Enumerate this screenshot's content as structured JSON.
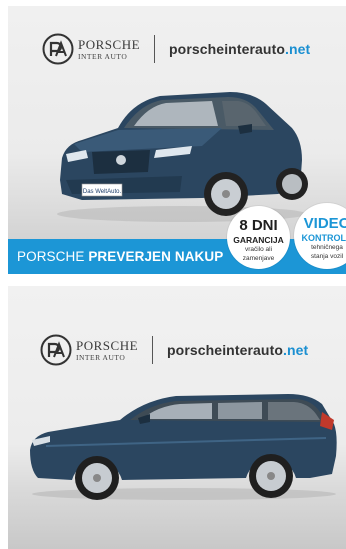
{
  "top_photo": {
    "brand_name": "PORSCHE",
    "brand_sub": "INTER AUTO",
    "website_main": "porscheinterauto",
    "website_tld": ".net",
    "plate_text": "Das WeltAuto.",
    "banner_regular": "PORSCHE",
    "banner_bold": "PREVERJEN NAKUP",
    "badge_guarantee": {
      "big": "8 DNI",
      "mid": "GARANCIJA",
      "line1": "vračilo ali",
      "line2": "zamenjave"
    },
    "badge_video": {
      "big": "VIDEO",
      "mid": "KONTROLA",
      "line1": "tehničnega",
      "line2": "stanja vozil"
    }
  },
  "bottom_photo": {
    "brand_name": "PORSCHE",
    "brand_sub": "INTER AUTO",
    "website_main": "porscheinterauto",
    "website_tld": ".net"
  },
  "colors": {
    "accent_blue": "#1c96d6",
    "car_blue": "#2b4660",
    "text_dark": "#333333"
  }
}
